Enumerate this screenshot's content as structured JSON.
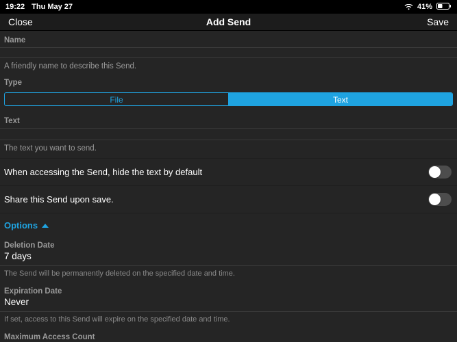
{
  "statusbar": {
    "time": "19:22",
    "date": "Thu May 27",
    "battery_pct": "41%"
  },
  "nav": {
    "close": "Close",
    "title": "Add Send",
    "save": "Save"
  },
  "name": {
    "label": "Name",
    "hint": "A friendly name to describe this Send."
  },
  "type": {
    "label": "Type",
    "file": "File",
    "text": "Text"
  },
  "textfield": {
    "label": "Text",
    "hint": "The text you want to send."
  },
  "toggles": {
    "hide_text": "When accessing the Send, hide the text by default",
    "share_on_save": "Share this Send upon save."
  },
  "options": {
    "label": "Options"
  },
  "deletion": {
    "label": "Deletion Date",
    "value": "7 days",
    "hint": "The Send will be permanently deleted on the specified date and time."
  },
  "expiration": {
    "label": "Expiration Date",
    "value": "Never",
    "hint": "If set, access to this Send will expire on the specified date and time."
  },
  "max_access": {
    "label": "Maximum Access Count"
  }
}
